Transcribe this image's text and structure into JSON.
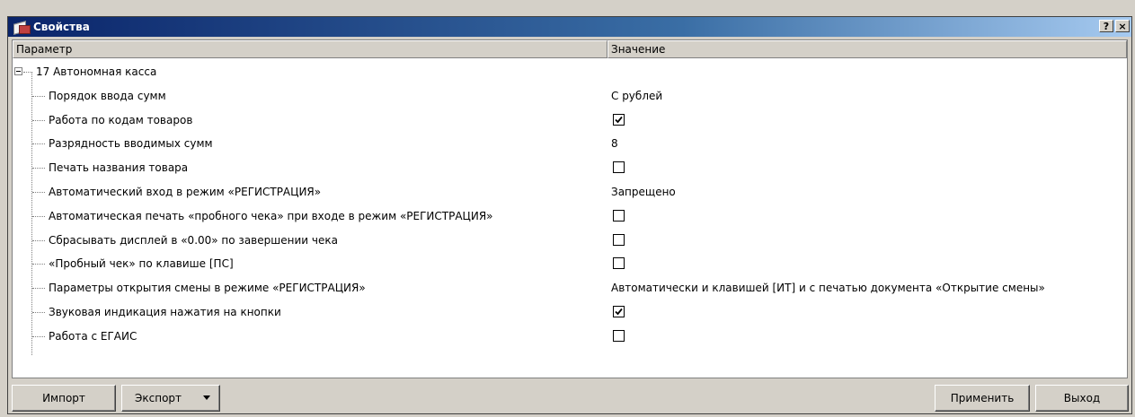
{
  "window": {
    "title": "Свойства",
    "help_label": "?",
    "close_label": "×"
  },
  "grid": {
    "columns": {
      "param": "Параметр",
      "value": "Значение"
    },
    "group": {
      "label": "17 Автономная касса"
    },
    "rows": [
      {
        "name": "Порядок ввода сумм",
        "type": "text",
        "value": "С рублей"
      },
      {
        "name": "Работа по кодам товаров",
        "type": "checkbox",
        "checked": true
      },
      {
        "name": "Разрядность вводимых сумм",
        "type": "text",
        "value": "8"
      },
      {
        "name": "Печать названия товара",
        "type": "checkbox",
        "checked": false
      },
      {
        "name": "Автоматический вход в режим «РЕГИСТРАЦИЯ»",
        "type": "text",
        "value": "Запрещено"
      },
      {
        "name": "Автоматическая печать «пробного чека» при входе в режим «РЕГИСТРАЦИЯ»",
        "type": "checkbox",
        "checked": false
      },
      {
        "name": "Сбрасывать дисплей в «0.00» по завершении чека",
        "type": "checkbox",
        "checked": false
      },
      {
        "name": "«Пробный чек» по клавише [ПС]",
        "type": "checkbox",
        "checked": false
      },
      {
        "name": "Параметры открытия смены в режиме «РЕГИСТРАЦИЯ»",
        "type": "text",
        "value": "Автоматически и клавишей [ИТ] и с печатью документа «Открытие смены»"
      },
      {
        "name": "Звуковая индикация нажатия на кнопки",
        "type": "checkbox",
        "checked": true
      },
      {
        "name": "Работа с ЕГАИС",
        "type": "checkbox",
        "checked": false
      }
    ]
  },
  "buttons": {
    "import": "Импорт",
    "export": "Экспорт",
    "apply": "Применить",
    "exit": "Выход"
  },
  "icons": {
    "app": "window-properties-icon",
    "help": "help-icon",
    "close": "close-icon",
    "expand": "tree-collapse-icon",
    "check": "checkmark-icon",
    "dropdown": "dropdown-arrow-icon"
  },
  "colors": {
    "titlebar_start": "#0a246a",
    "titlebar_end": "#a6caf0",
    "face": "#d4d0c8"
  }
}
